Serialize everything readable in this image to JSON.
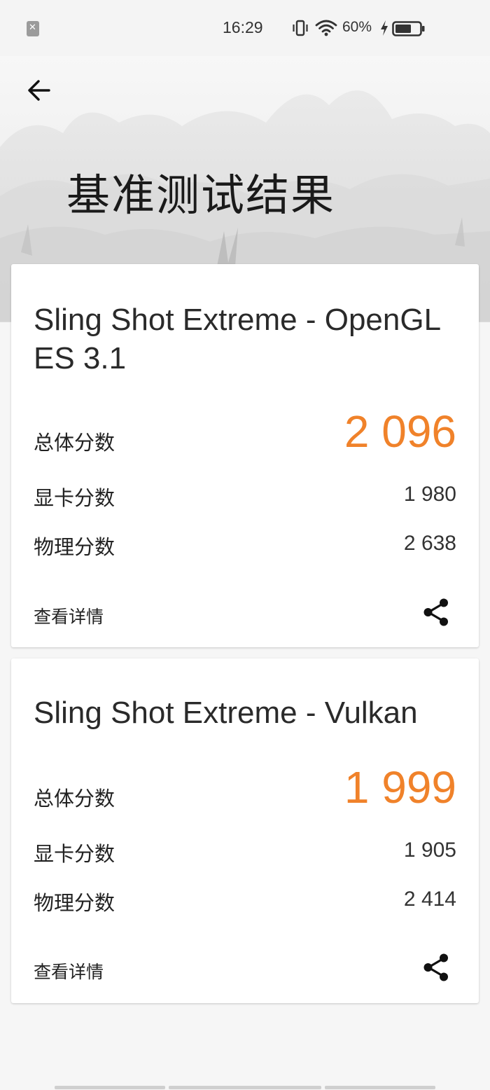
{
  "status_bar": {
    "time": "16:29",
    "battery": "60%",
    "icons": [
      "notification-blocked-icon",
      "vibrate-icon",
      "wifi-icon",
      "charging-bolt-icon",
      "battery-icon"
    ]
  },
  "header": {
    "title": "基准测试结果",
    "back_icon": "arrow-left-icon"
  },
  "results": [
    {
      "test_name": "Sling Shot Extreme - OpenGL ES 3.1",
      "total_label": "总体分数",
      "total_score": "2 096",
      "graphics_label": "显卡分数",
      "graphics_score": "1 980",
      "physics_label": "物理分数",
      "physics_score": "2 638",
      "details_label": "查看详情",
      "share_icon": "share-icon"
    },
    {
      "test_name": "Sling Shot Extreme - Vulkan",
      "total_label": "总体分数",
      "total_score": "1 999",
      "graphics_label": "显卡分数",
      "graphics_score": "1 905",
      "physics_label": "物理分数",
      "physics_score": "2 414",
      "details_label": "查看详情",
      "share_icon": "share-icon"
    }
  ],
  "colors": {
    "accent": "#f0822a",
    "background": "#f6f6f6",
    "card": "#ffffff"
  }
}
